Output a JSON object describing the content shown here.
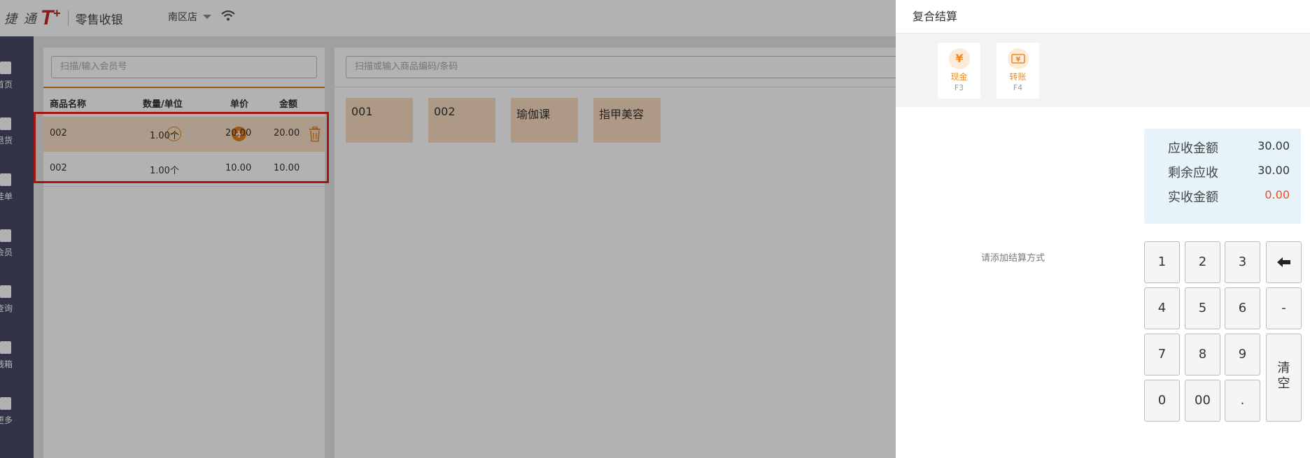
{
  "app": {
    "brand_cn": "捷 通",
    "brand_t": "T",
    "brand_plus": "+",
    "app_name": "零售收银",
    "store": "南区店"
  },
  "sidebar": {
    "items": [
      {
        "label": "首页",
        "icon": "home-icon"
      },
      {
        "label": "退货",
        "icon": "return-icon"
      },
      {
        "label": "挂单",
        "icon": "pending-order-icon"
      },
      {
        "label": "会员",
        "icon": "member-icon"
      },
      {
        "label": "查询",
        "icon": "search-icon"
      },
      {
        "label": "钱箱",
        "icon": "cashbox-icon"
      },
      {
        "label": "更多",
        "icon": "grid-icon"
      }
    ]
  },
  "cart": {
    "member_placeholder": "扫描/输入会员号",
    "columns": [
      "商品名称",
      "数量/单位",
      "单价",
      "金额"
    ],
    "rows": [
      {
        "name": "002",
        "qty": "1.00个",
        "price": "20.00",
        "amount": "20.00"
      },
      {
        "name": "002",
        "qty": "1.00个",
        "price": "10.00",
        "amount": "10.00"
      }
    ]
  },
  "products": {
    "search_placeholder": "扫描或输入商品编码/条码",
    "tiles": [
      "001",
      "002",
      "瑜伽课",
      "指甲美容"
    ]
  },
  "dialog": {
    "title": "复合结算",
    "methods": [
      {
        "label": "现金",
        "key": "F3",
        "glyph": "¥",
        "icon": "cash-icon"
      },
      {
        "label": "转账",
        "key": "F4",
        "glyph": "¥",
        "icon": "transfer-icon"
      }
    ],
    "amounts": [
      {
        "label": "应收金额",
        "value": "30.00"
      },
      {
        "label": "剩余应收",
        "value": "30.00"
      },
      {
        "label": "实收金额",
        "value": "0.00"
      }
    ],
    "hint": "请添加结算方式",
    "keypad": {
      "k1": "1",
      "k2": "2",
      "k3": "3",
      "k4": "4",
      "k5": "5",
      "k6": "6",
      "minus": "-",
      "k7": "7",
      "k8": "8",
      "k9": "9",
      "k0": "0",
      "k00": "00",
      "dot": ".",
      "clear_1": "清",
      "clear_2": "空"
    }
  },
  "colors": {
    "accent": "#e8801d",
    "highlight_border": "#e8211d",
    "sidebar": "#4a4a68",
    "amount_box": "#e6f3fb",
    "negative": "#f04a24"
  }
}
